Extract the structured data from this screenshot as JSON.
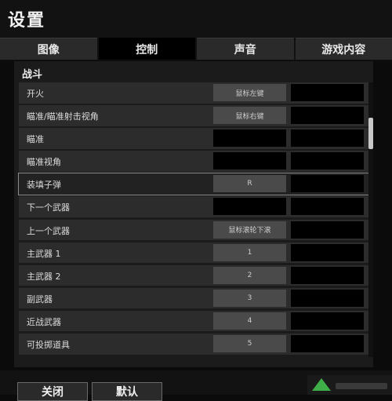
{
  "window": {
    "title": "设置"
  },
  "tabs": [
    {
      "label": "图像",
      "active": false
    },
    {
      "label": "控制",
      "active": true
    },
    {
      "label": "声音",
      "active": false
    },
    {
      "label": "游戏内容",
      "active": false
    }
  ],
  "section": {
    "title": "战斗"
  },
  "rows": [
    {
      "action": "开火",
      "key": "鼠标左键"
    },
    {
      "action": "瞄准/瞄准射击视角",
      "key": "鼠标右键"
    },
    {
      "action": "瞄准",
      "key": ""
    },
    {
      "action": "瞄准视角",
      "key": ""
    },
    {
      "action": "装填子弹",
      "key": "R"
    },
    {
      "action": "下一个武器",
      "key": ""
    },
    {
      "action": "上一个武器",
      "key": "鼠标滚轮下滚"
    },
    {
      "action": "主武器 1",
      "key": "1"
    },
    {
      "action": "主武器 2",
      "key": "2"
    },
    {
      "action": "副武器",
      "key": "3"
    },
    {
      "action": "近战武器",
      "key": "4"
    },
    {
      "action": "可投掷道具",
      "key": "5"
    }
  ],
  "footer": {
    "close_label": "关闭",
    "default_label": "默认"
  },
  "colors": {
    "background": "#0b0b0b",
    "tab_active": "#000000",
    "tab_inactive": "#2a2a2a",
    "row": "#2c2c2c",
    "watermark_green": "#3fae49"
  }
}
